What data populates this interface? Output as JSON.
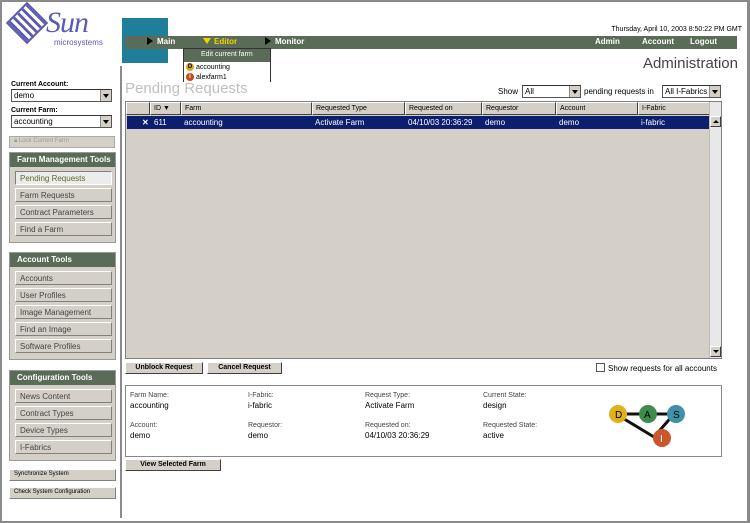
{
  "brand": {
    "name": "Sun",
    "sub": "microsystems"
  },
  "header": {
    "date": "Thursday, April 10, 2003 8:50:22 PM GMT",
    "title": "Administration",
    "nav": {
      "main": "Main",
      "editor": "Editor",
      "monitor": "Monitor"
    },
    "right_links": {
      "admin": "Admin",
      "account": "Account",
      "logout": "Logout"
    }
  },
  "editor_menu": {
    "header": "Edit current farm",
    "items": [
      {
        "badge": "D",
        "label": "accounting"
      },
      {
        "badge": "i",
        "label": "alexfarm1"
      }
    ]
  },
  "left": {
    "current_account_label": "Current Account:",
    "current_account_value": "demo",
    "current_farm_label": "Current Farm:",
    "current_farm_value": "accounting",
    "lock_label": "Lock Current Farm",
    "farm_tools": {
      "title": "Farm Management Tools",
      "items": [
        "Pending Requests",
        "Farm Requests",
        "Contract Parameters",
        "Find a Farm"
      ]
    },
    "account_tools": {
      "title": "Account Tools",
      "items": [
        "Accounts",
        "User Profiles",
        "Image Management",
        "Find an Image",
        "Software Profiles"
      ]
    },
    "config_tools": {
      "title": "Configuration Tools",
      "items": [
        "News Content",
        "Contract Types",
        "Device Types",
        "I-Fabrics"
      ]
    },
    "sync_label": "Synchronize System",
    "check_label": "Check System Configuration"
  },
  "main": {
    "title": "Pending Requests",
    "show_label": "Show",
    "show_value": "All",
    "pending_label": "pending requests in",
    "fabric_value": "All I-Fabrics",
    "columns": [
      "ID",
      "Farm",
      "Requested Type",
      "Requested on",
      "Requestor",
      "Account",
      "I-Fabric"
    ],
    "row": {
      "mark": "✕",
      "id": "611",
      "farm": "accounting",
      "type": "Activate Farm",
      "on": "04/10/03 20:36:29",
      "requestor": "demo",
      "account": "demo",
      "fabric": "i-fabric"
    },
    "unblock_label": "Unblock Request",
    "cancel_label": "Cancel Request",
    "show_all_label": "Show requests for all accounts",
    "view_label": "View Selected Farm"
  },
  "detail": {
    "farm_name_label": "Farm Name:",
    "farm_name": "accounting",
    "ifabric_label": "I-Fabric:",
    "ifabric": "i-fabric",
    "req_type_label": "Request Type:",
    "req_type": "Activate Farm",
    "cur_state_label": "Current State:",
    "cur_state": "design",
    "account_label": "Account:",
    "account": "demo",
    "requestor_label": "Requestor:",
    "requestor": "demo",
    "requested_on_label": "Requested on:",
    "requested_on": "04/10/03 20:36:29",
    "req_state_label": "Requested State:",
    "req_state": "active",
    "diagram": {
      "d": "D",
      "a": "A",
      "s": "S",
      "i": "I"
    }
  },
  "colors": {
    "nav_green": "#5a6b57",
    "teal": "#1f7f9a",
    "selected_row": "#0c1f6e",
    "highlight_yellow": "#f2d500"
  }
}
